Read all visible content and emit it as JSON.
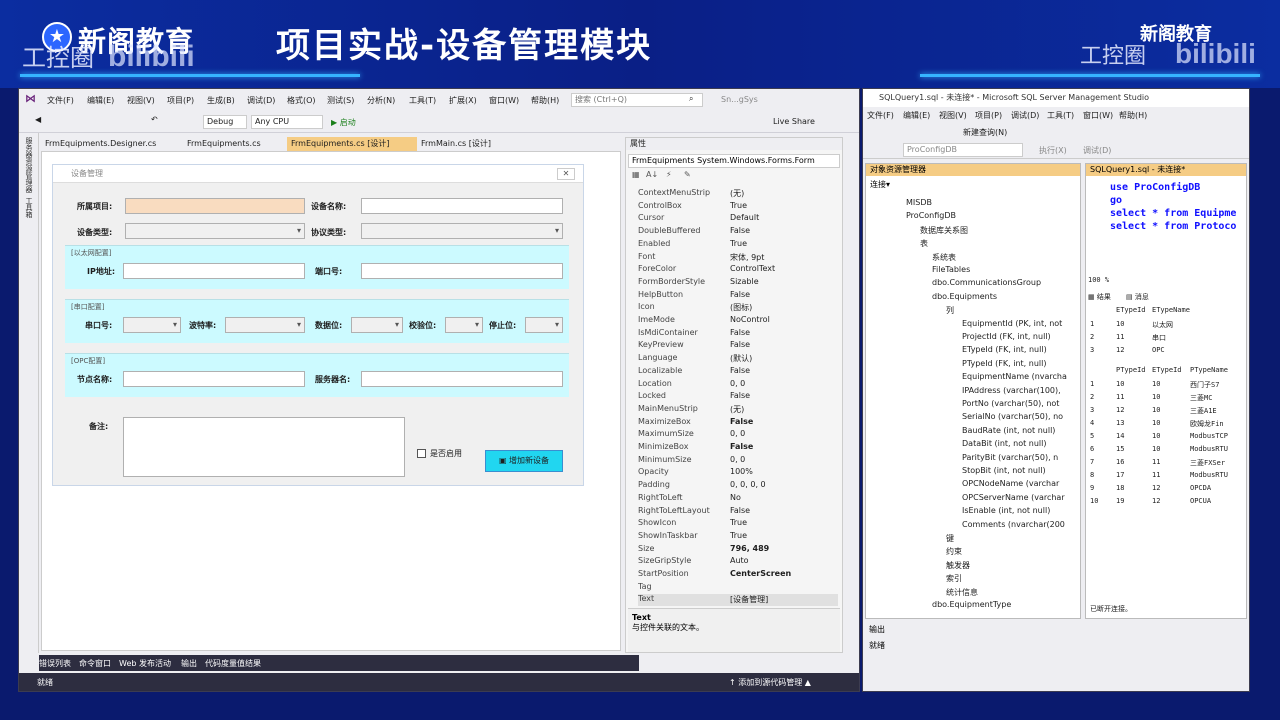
{
  "banner": {
    "logo_text": "新阁教育",
    "logo_sub": "工控圈",
    "bili": "bilibili",
    "headline": "项目实战-设备管理模块",
    "right_logo": "新阁教育",
    "right_sub": "工控圈",
    "right_bili": "bilibili"
  },
  "vs": {
    "menu": [
      "文件(F)",
      "编辑(E)",
      "视图(V)",
      "项目(P)",
      "生成(B)",
      "调试(D)",
      "格式(O)",
      "测试(S)",
      "分析(N)",
      "工具(T)",
      "扩展(X)",
      "窗口(W)",
      "帮助(H)"
    ],
    "search_placeholder": "搜索 (Ctrl+Q)",
    "solution": "Sn...gSys",
    "config": "Debug",
    "platform": "Any CPU",
    "start": "▶ 启动",
    "live_share": "Live Share",
    "tabs": [
      "FrmEquipments.Designer.cs",
      "FrmEquipments.cs",
      "FrmEquipments.cs [设计]",
      "FrmMain.cs [设计]"
    ],
    "side_tabs": [
      "服务器资源管理器",
      "工具箱"
    ],
    "form": {
      "title": "设备管理",
      "close": "✕",
      "project_label": "所属项目:",
      "device_name_label": "设备名称:",
      "device_type_label": "设备类型:",
      "protocol_label": "协议类型:",
      "eth_group": "[以太网配置]",
      "ip_label": "IP地址:",
      "port_label": "端口号:",
      "serial_group": "[串口配置]",
      "com_label": "串口号:",
      "baud_label": "波特率:",
      "databit_label": "数据位:",
      "parity_label": "校验位:",
      "stopbit_label": "停止位:",
      "opc_group": "[OPC配置]",
      "node_label": "节点名称:",
      "server_label": "服务器名:",
      "remark_label": "备注:",
      "enable_label": "是否启用",
      "add_button": "增加新设备"
    },
    "bottom_tabs": [
      "错误列表",
      "命令窗口",
      "Web 发布活动",
      "输出",
      "代码度量值结果"
    ],
    "status_left": "就绪",
    "status_right": "↑ 添加到源代码管理 ▲"
  },
  "properties": {
    "header": "属性",
    "object": "FrmEquipments  System.Windows.Forms.Form",
    "rows": [
      {
        "n": "ContextMenuStrip",
        "v": "(无)"
      },
      {
        "n": "ControlBox",
        "v": "True"
      },
      {
        "n": "Cursor",
        "v": "Default"
      },
      {
        "n": "DoubleBuffered",
        "v": "False"
      },
      {
        "n": "Enabled",
        "v": "True"
      },
      {
        "n": "Font",
        "v": "宋体, 9pt"
      },
      {
        "n": "ForeColor",
        "v": "ControlText"
      },
      {
        "n": "FormBorderStyle",
        "v": "Sizable"
      },
      {
        "n": "HelpButton",
        "v": "False"
      },
      {
        "n": "Icon",
        "v": "(图标)"
      },
      {
        "n": "ImeMode",
        "v": "NoControl"
      },
      {
        "n": "IsMdiContainer",
        "v": "False"
      },
      {
        "n": "KeyPreview",
        "v": "False"
      },
      {
        "n": "Language",
        "v": "(默认)"
      },
      {
        "n": "Localizable",
        "v": "False"
      },
      {
        "n": "Location",
        "v": "0, 0"
      },
      {
        "n": "Locked",
        "v": "False"
      },
      {
        "n": "MainMenuStrip",
        "v": "(无)"
      },
      {
        "n": "MaximizeBox",
        "v": "False"
      },
      {
        "n": "MaximumSize",
        "v": "0, 0"
      },
      {
        "n": "MinimizeBox",
        "v": "False"
      },
      {
        "n": "MinimumSize",
        "v": "0, 0"
      },
      {
        "n": "Opacity",
        "v": "100%"
      },
      {
        "n": "Padding",
        "v": "0, 0, 0, 0"
      },
      {
        "n": "RightToLeft",
        "v": "No"
      },
      {
        "n": "RightToLeftLayout",
        "v": "False"
      },
      {
        "n": "ShowIcon",
        "v": "True"
      },
      {
        "n": "ShowInTaskbar",
        "v": "True"
      },
      {
        "n": "Size",
        "v": "796, 489"
      },
      {
        "n": "SizeGripStyle",
        "v": "Auto"
      },
      {
        "n": "StartPosition",
        "v": "CenterScreen"
      },
      {
        "n": "Tag",
        "v": ""
      },
      {
        "n": "Text",
        "v": "[设备管理]"
      }
    ],
    "desc_title": "Text",
    "desc_text": "与控件关联的文本。"
  },
  "ssms": {
    "title": "SQLQuery1.sql - 未连接* - Microsoft SQL Server Management Studio",
    "menu": [
      "文件(F)",
      "编辑(E)",
      "视图(V)",
      "项目(P)",
      "调试(D)",
      "工具(T)",
      "窗口(W)",
      "帮助(H)"
    ],
    "new_query": "新建查询(N)",
    "db_combo": "ProConfigDB",
    "execute": "执行(X)",
    "debug": "调试(D)",
    "oe_title": "对象资源管理器",
    "connect": "连接▾",
    "tree": [
      "MISDB",
      "ProConfigDB",
      "数据库关系图",
      "表",
      "系统表",
      "FileTables",
      "dbo.CommunicationsGroup",
      "dbo.Equipments",
      "列",
      "EquipmentId (PK, int, not",
      "ProjectId (FK, int, null)",
      "ETypeId (FK, int, null)",
      "PTypeId (FK, int, null)",
      "EquipmentName (nvarcha",
      "IPAddress (varchar(100),",
      "PortNo (varchar(50), not",
      "SerialNo (varchar(50), no",
      "BaudRate (int, not null)",
      "DataBit (int, not null)",
      "ParityBit (varchar(50), n",
      "StopBit (int, not null)",
      "OPCNodeName (varchar",
      "OPCServerName (varchar",
      "IsEnable (int, not null)",
      "Comments (nvarchar(200",
      "键",
      "约束",
      "触发器",
      "索引",
      "统计信息",
      "dbo.EquipmentType"
    ],
    "query_tab": "SQLQuery1.sql - 未连接*",
    "code": [
      {
        "kw": "use",
        "rest": " ProConfigDB"
      },
      {
        "kw": "go",
        "rest": ""
      },
      {
        "kw": "select",
        "rest": " * from Equipme"
      },
      {
        "kw": "select",
        "rest": " * from Protoco"
      }
    ],
    "zoom": "100 %",
    "results_tab": "结果",
    "messages_tab": "消息",
    "grid1_headers": [
      "ETypeId",
      "ETypeName"
    ],
    "grid1_rows": [
      [
        "1",
        "10",
        "以太网"
      ],
      [
        "2",
        "11",
        "串口"
      ],
      [
        "3",
        "12",
        "OPC"
      ]
    ],
    "grid2_headers": [
      "PTypeId",
      "ETypeId",
      "PTypeName"
    ],
    "grid2_rows": [
      [
        "1",
        "10",
        "10",
        "西门子S7"
      ],
      [
        "2",
        "11",
        "10",
        "三菱MC"
      ],
      [
        "3",
        "12",
        "10",
        "三菱A1E"
      ],
      [
        "4",
        "13",
        "10",
        "欧姆龙Fin"
      ],
      [
        "5",
        "14",
        "10",
        "ModbusTCP"
      ],
      [
        "6",
        "15",
        "10",
        "ModbusRTU"
      ],
      [
        "7",
        "16",
        "11",
        "三菱FXSer"
      ],
      [
        "8",
        "17",
        "11",
        "ModbusRTU"
      ],
      [
        "9",
        "18",
        "12",
        "OPCDA"
      ],
      [
        "10",
        "19",
        "12",
        "OPCUA"
      ]
    ],
    "connected": "已断开连接。",
    "output": "输出",
    "status": "就绪"
  }
}
